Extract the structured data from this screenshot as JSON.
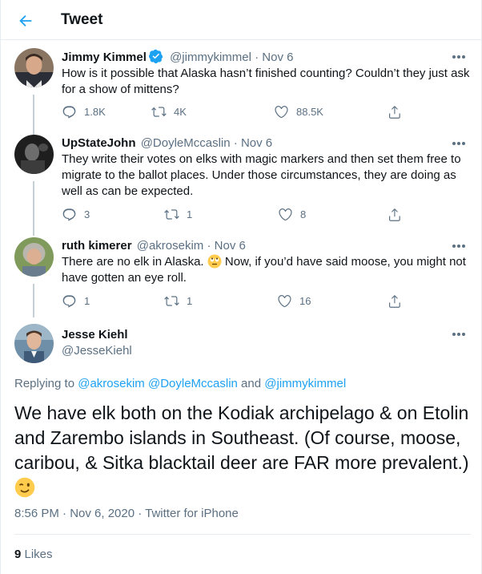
{
  "header": {
    "title": "Tweet"
  },
  "tweets": [
    {
      "name": "Jimmy Kimmel",
      "handle": "@jimmykimmel",
      "sep": "·",
      "date": "Nov 6",
      "text": "How is it possible that Alaska hasn’t finished counting? Couldn’t they just ask for a show of mittens?",
      "replies": "1.8K",
      "retweets": "4K",
      "likes": "88.5K"
    },
    {
      "name": "UpStateJohn",
      "handle": "@DoyleMccaslin",
      "sep": "·",
      "date": "Nov 6",
      "text": "They write their votes on elks with magic markers and then set them free to migrate to the ballot places.  Under those circumstances, they are doing as well as can be expected.",
      "replies": "3",
      "retweets": "1",
      "likes": "8"
    },
    {
      "name": "ruth kimerer",
      "handle": "@akrosekim",
      "sep": "·",
      "date": "Nov 6",
      "text_a": "There are no elk in Alaska. ",
      "text_b": "  Now, if you’d have said moose, you might not have gotten an eye roll.",
      "replies": "1",
      "retweets": "1",
      "likes": "16"
    }
  ],
  "main": {
    "name": "Jesse Kiehl",
    "handle": "@JesseKiehl",
    "replying_prefix": "Replying to ",
    "mention1": "@akrosekim",
    "mention2": "@DoyleMccaslin",
    "and": " and ",
    "mention3": "@jimmykimmel",
    "text": "We have elk both on the Kodiak archipelago & on Etolin and Zarembo islands in Southeast.  (Of course, moose, caribou, & Sitka blacktail deer are FAR more prevalent.) ",
    "timestamp": "8:56 PM · Nov 6, 2020 · Twitter for iPhone",
    "likes_count": "9",
    "likes_label": " Likes"
  },
  "colors": {
    "accent": "#1da1f2",
    "muted": "#5b7083",
    "verified": "#1da1f2"
  },
  "icons": [
    "back-arrow-icon",
    "verified-badge-icon",
    "more-icon",
    "reply-icon",
    "retweet-icon",
    "like-icon",
    "share-icon",
    "eye-roll-emoji-icon",
    "wink-emoji-icon"
  ]
}
